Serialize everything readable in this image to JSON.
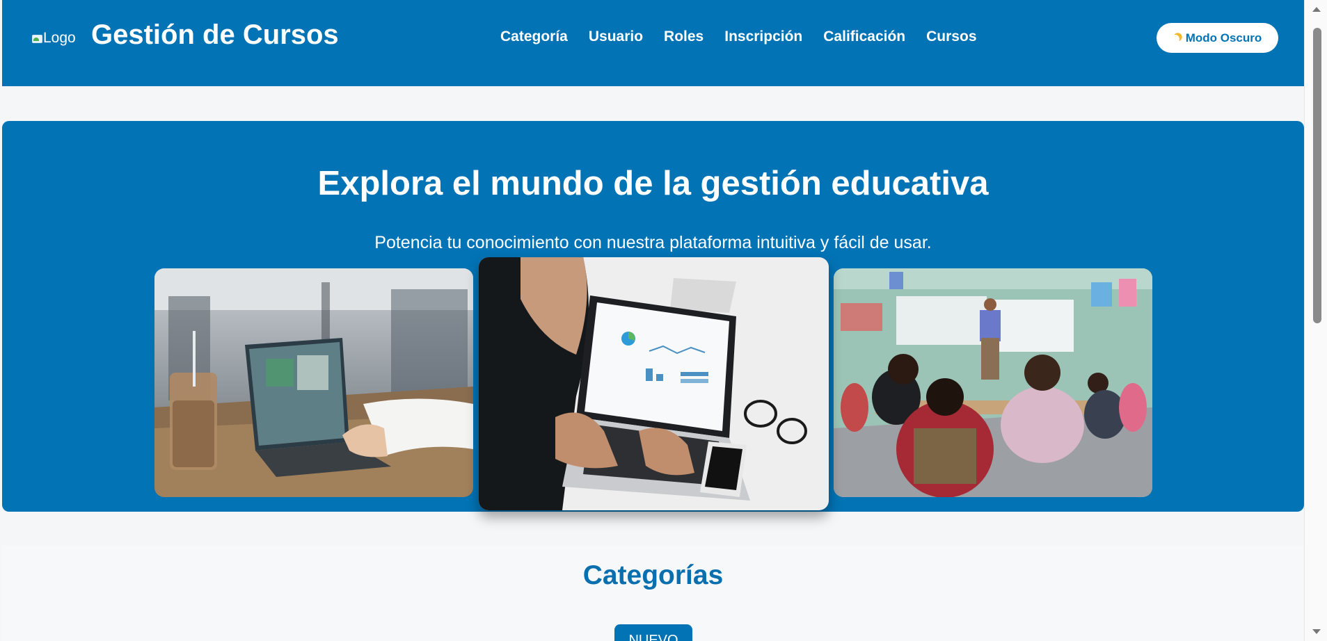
{
  "header": {
    "logo_alt": "Logo",
    "title": "Gestión de Cursos",
    "nav": [
      {
        "label": "Categoría"
      },
      {
        "label": "Usuario"
      },
      {
        "label": "Roles"
      },
      {
        "label": "Inscripción"
      },
      {
        "label": "Calificación"
      },
      {
        "label": "Cursos"
      }
    ],
    "dark_mode_label": "Modo Oscuro"
  },
  "hero": {
    "title": "Explora el mundo de la gestión educativa",
    "subtitle": "Potencia tu conocimiento con nuestra plataforma intuitiva y fácil de usar."
  },
  "categories": {
    "title": "Categorías",
    "new_button": "NUEVO"
  },
  "colors": {
    "primary": "#0273b5",
    "background": "#f4f6f8",
    "moon": "#f1b92a"
  },
  "icons": [
    "broken-image-icon",
    "moon-icon",
    "scroll-up-arrow-icon",
    "scroll-down-arrow-icon"
  ]
}
